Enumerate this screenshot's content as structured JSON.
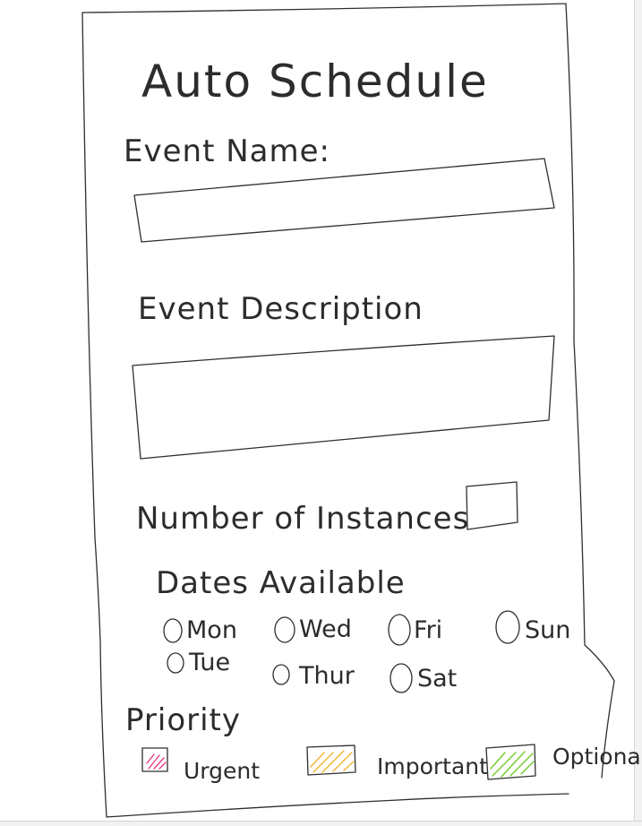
{
  "form": {
    "title": "Auto Schedule",
    "event_name_label": "Event Name:",
    "event_name_value": "",
    "event_description_label": "Event Description",
    "event_description_value": "",
    "instances_label": "Number of Instances",
    "instances_value": "",
    "dates_label": "Dates Available",
    "days": [
      {
        "label": "Mon",
        "checked": false
      },
      {
        "label": "Wed",
        "checked": false
      },
      {
        "label": "Fri",
        "checked": false
      },
      {
        "label": "Sun",
        "checked": false
      },
      {
        "label": "Tue",
        "checked": false
      },
      {
        "label": "Thur",
        "checked": false
      },
      {
        "label": "Sat",
        "checked": false
      }
    ],
    "priority_label": "Priority",
    "priorities": [
      {
        "label": "Urgent",
        "color": "#e63c8a"
      },
      {
        "label": "Important",
        "color": "#f2b32e"
      },
      {
        "label": "Optional",
        "color": "#6ecb2a"
      }
    ]
  }
}
